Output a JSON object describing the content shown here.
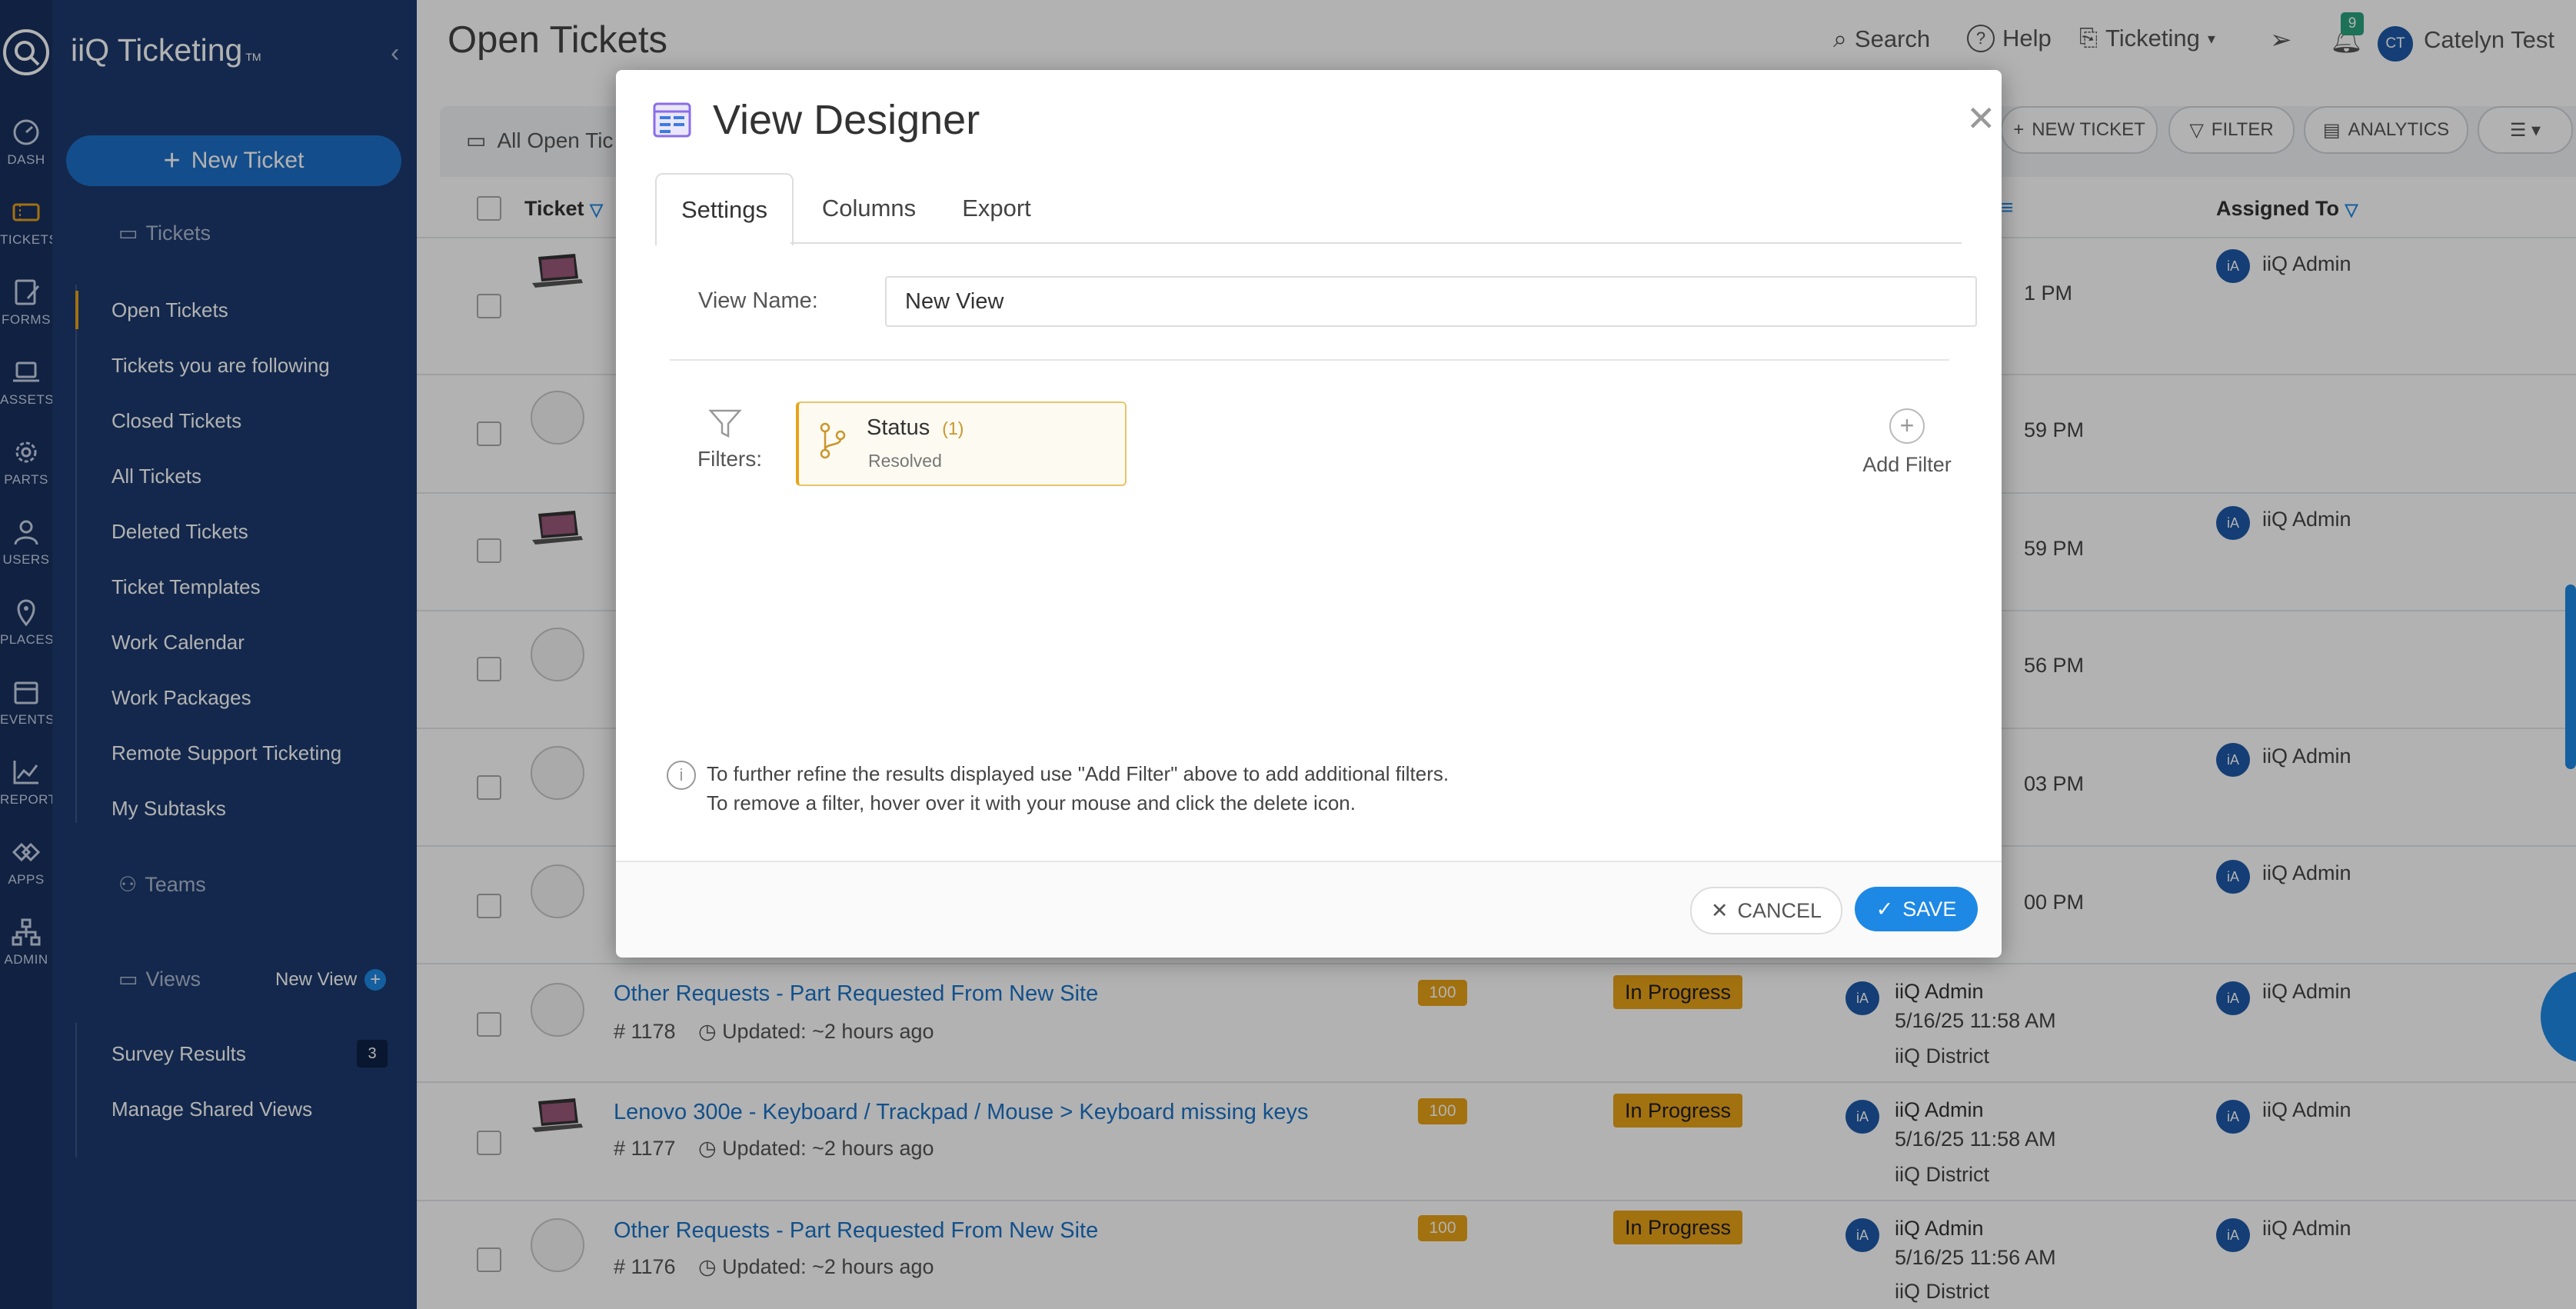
{
  "brand": {
    "name": "iiQ Ticketing",
    "tm": "TM"
  },
  "rail": [
    {
      "label": "DASH",
      "icon": "dashboard-icon"
    },
    {
      "label": "TICKETS",
      "icon": "tickets-icon"
    },
    {
      "label": "FORMS",
      "icon": "forms-icon"
    },
    {
      "label": "ASSETS",
      "icon": "laptop-icon"
    },
    {
      "label": "PARTS",
      "icon": "gear-icon"
    },
    {
      "label": "USERS",
      "icon": "user-icon"
    },
    {
      "label": "PLACES",
      "icon": "map-pin-icon"
    },
    {
      "label": "EVENTS",
      "icon": "calendar-icon"
    },
    {
      "label": "REPORT",
      "icon": "chart-icon"
    },
    {
      "label": "APPS",
      "icon": "apps-icon"
    },
    {
      "label": "ADMIN",
      "icon": "org-chart-icon"
    }
  ],
  "nav": {
    "new_ticket": "New Ticket",
    "tickets_section": "Tickets",
    "ticket_links": [
      "Open Tickets",
      "Tickets you are following",
      "Closed Tickets",
      "All Tickets",
      "Deleted Tickets",
      "Ticket Templates",
      "Work Calendar",
      "Work Packages",
      "Remote Support Ticketing",
      "My Subtasks"
    ],
    "teams_section": "Teams",
    "views_section": "Views",
    "new_view": "New View",
    "view_links": [
      "Survey Results",
      "Manage Shared Views"
    ],
    "survey_count": "3"
  },
  "header": {
    "title": "Open Tickets",
    "search": "Search",
    "help": "Help",
    "module": "Ticketing",
    "notif_count": "9",
    "user_initials": "CT",
    "user_name": "Catelyn Test"
  },
  "toolbar": {
    "view_selector": "All Open Tic",
    "new_ticket": "NEW TICKET",
    "filter": "FILTER",
    "analytics": "ANALYTICS"
  },
  "columns": {
    "ticket": "Ticket",
    "assigned_to": "Assigned To"
  },
  "partial_times": [
    "1 PM",
    "59 PM",
    "59 PM",
    "56 PM",
    "03 PM",
    "00 PM"
  ],
  "rows": [
    {
      "title": "Other Requests - Part Requested From New Site",
      "number": "# 1178",
      "updated": "Updated: ~2 hours ago",
      "priority": "100",
      "status": "In Progress",
      "avatar": "iA",
      "owner": "iiQ Admin",
      "date": "5/16/25 11:58 AM",
      "site": "iiQ District",
      "assigned": "iiQ Admin"
    },
    {
      "title": "Lenovo 300e - Keyboard / Trackpad / Mouse > Keyboard missing keys",
      "number": "# 1177",
      "updated": "Updated: ~2 hours ago",
      "priority": "100",
      "status": "In Progress",
      "avatar": "iA",
      "owner": "iiQ Admin",
      "date": "5/16/25 11:58 AM",
      "site": "iiQ District",
      "assigned": "iiQ Admin"
    },
    {
      "title": "Other Requests - Part Requested From New Site",
      "number": "# 1176",
      "updated": "Updated: ~2 hours ago",
      "priority": "100",
      "status": "In Progress",
      "avatar": "iA",
      "owner": "iiQ Admin",
      "date": "5/16/25 11:56 AM",
      "site": "iiQ District",
      "assigned": "iiQ Admin"
    }
  ],
  "assigned_upper": [
    "iiQ Admin",
    "iiQ Admin",
    "iiQ Admin",
    "iiQ Admin"
  ],
  "modal": {
    "title": "View Designer",
    "tabs": [
      "Settings",
      "Columns",
      "Export"
    ],
    "view_name_label": "View Name:",
    "view_name_value": "New View",
    "filters_label": "Filters:",
    "filter_name": "Status",
    "filter_count": "(1)",
    "filter_value": "Resolved",
    "add_filter": "Add Filter",
    "info_line1": "To further refine the results displayed use \"Add Filter\" above to add additional filters.",
    "info_line2": "To remove a filter, hover over it with your mouse and click the delete icon.",
    "cancel": "CANCEL",
    "save": "SAVE"
  },
  "colors": {
    "sidebar": "#1c3a6e",
    "rail": "#17305f",
    "accent": "#1e88e5",
    "status": "#e8a317"
  }
}
